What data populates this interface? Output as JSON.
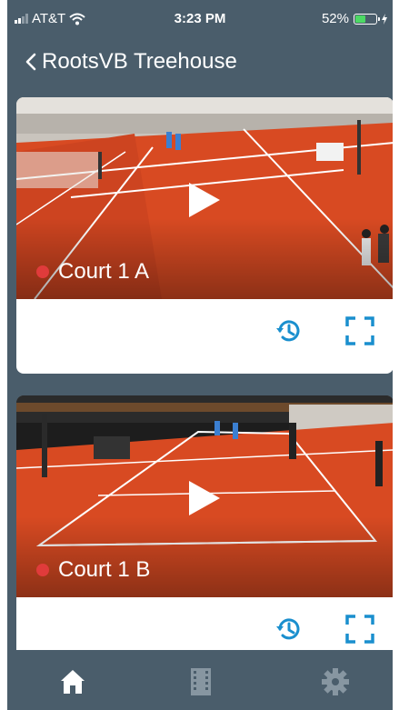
{
  "status_bar": {
    "carrier": "AT&T",
    "time": "3:23 PM",
    "battery": "52%",
    "battery_level": 0.52
  },
  "nav": {
    "title": "RootsVB Treehouse"
  },
  "cameras": [
    {
      "name": "Court 1 A"
    },
    {
      "name": "Court 1 B"
    }
  ],
  "tabbar": {
    "items": [
      "home-icon",
      "film-icon",
      "gear-icon"
    ]
  },
  "colors": {
    "background": "#4a5d6b",
    "accent": "#1a8fce",
    "court": "#d84a22",
    "live": "#e03b3b"
  }
}
